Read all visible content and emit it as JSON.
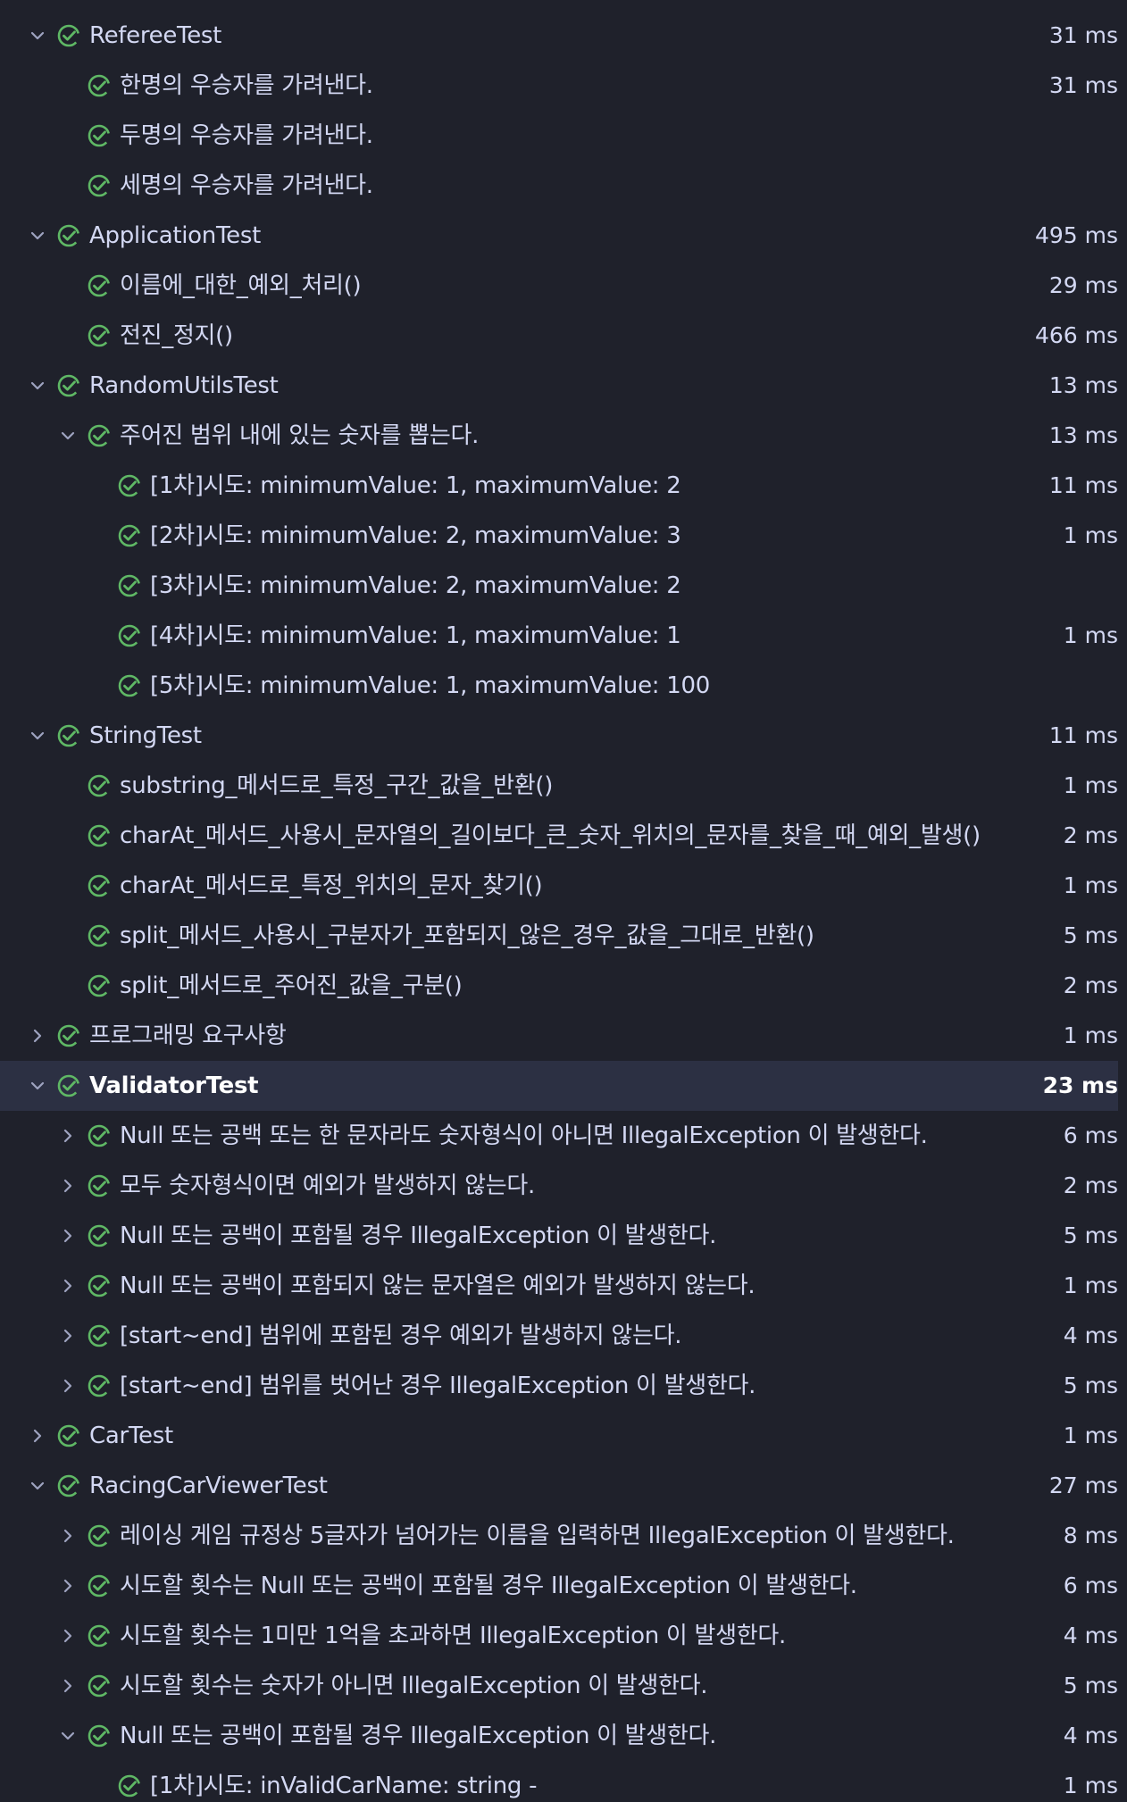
{
  "colors": {
    "background": "#1f212b",
    "selected_row": "#2c3043",
    "pass_icon": "#5fb865",
    "chevron": "#9ea3c0",
    "text": "#d3d8f3"
  },
  "rows": [
    {
      "level": 0,
      "expand": "expanded",
      "label": "RefereeTest",
      "time": "31 ms"
    },
    {
      "level": 1,
      "expand": "none",
      "label": "한명의 우승자를 가려낸다.",
      "time": "31 ms"
    },
    {
      "level": 1,
      "expand": "none",
      "label": "두명의 우승자를 가려낸다.",
      "time": ""
    },
    {
      "level": 1,
      "expand": "none",
      "label": "세명의 우승자를 가려낸다.",
      "time": ""
    },
    {
      "level": 0,
      "expand": "expanded",
      "label": "ApplicationTest",
      "time": "495 ms"
    },
    {
      "level": 1,
      "expand": "none",
      "label": "이름에_대한_예외_처리()",
      "time": "29 ms"
    },
    {
      "level": 1,
      "expand": "none",
      "label": "전진_정지()",
      "time": "466 ms"
    },
    {
      "level": 0,
      "expand": "expanded",
      "label": "RandomUtilsTest",
      "time": "13 ms"
    },
    {
      "level": 1,
      "expand": "expanded",
      "label": "주어진 범위 내에 있는 숫자를 뽑는다.",
      "time": "13 ms"
    },
    {
      "level": 2,
      "expand": "none",
      "label": "[1차]시도: minimumValue: 1, maximumValue: 2",
      "time": "11 ms"
    },
    {
      "level": 2,
      "expand": "none",
      "label": "[2차]시도: minimumValue: 2, maximumValue: 3",
      "time": "1 ms"
    },
    {
      "level": 2,
      "expand": "none",
      "label": "[3차]시도: minimumValue: 2, maximumValue: 2",
      "time": ""
    },
    {
      "level": 2,
      "expand": "none",
      "label": "[4차]시도: minimumValue: 1, maximumValue: 1",
      "time": "1 ms"
    },
    {
      "level": 2,
      "expand": "none",
      "label": "[5차]시도: minimumValue: 1, maximumValue: 100",
      "time": ""
    },
    {
      "level": 0,
      "expand": "expanded",
      "label": "StringTest",
      "time": "11 ms"
    },
    {
      "level": 1,
      "expand": "none",
      "label": "substring_메서드로_특정_구간_값을_반환()",
      "time": "1 ms"
    },
    {
      "level": 1,
      "expand": "none",
      "label": "charAt_메서드_사용시_문자열의_길이보다_큰_숫자_위치의_문자를_찾을_때_예외_발생()",
      "time": "2 ms"
    },
    {
      "level": 1,
      "expand": "none",
      "label": "charAt_메서드로_특정_위치의_문자_찾기()",
      "time": "1 ms"
    },
    {
      "level": 1,
      "expand": "none",
      "label": "split_메서드_사용시_구분자가_포함되지_않은_경우_값을_그대로_반환()",
      "time": "5 ms"
    },
    {
      "level": 1,
      "expand": "none",
      "label": "split_메서드로_주어진_값을_구분()",
      "time": "2 ms"
    },
    {
      "level": 0,
      "expand": "collapsed",
      "label": "프로그래밍 요구사항",
      "time": "1 ms"
    },
    {
      "level": 0,
      "expand": "expanded",
      "label": "ValidatorTest",
      "time": "23 ms",
      "selected": true
    },
    {
      "level": 1,
      "expand": "collapsed",
      "label": "Null 또는 공백 또는 한 문자라도 숫자형식이 아니면 IllegalException 이 발생한다.",
      "time": "6 ms"
    },
    {
      "level": 1,
      "expand": "collapsed",
      "label": "모두 숫자형식이면 예외가 발생하지 않는다.",
      "time": "2 ms"
    },
    {
      "level": 1,
      "expand": "collapsed",
      "label": "Null 또는 공백이 포함될 경우 IllegalException 이 발생한다.",
      "time": "5 ms"
    },
    {
      "level": 1,
      "expand": "collapsed",
      "label": "Null 또는 공백이 포함되지 않는 문자열은 예외가 발생하지 않는다.",
      "time": "1 ms"
    },
    {
      "level": 1,
      "expand": "collapsed",
      "label": "[start~end] 범위에 포함된 경우 예외가 발생하지 않는다.",
      "time": "4 ms"
    },
    {
      "level": 1,
      "expand": "collapsed",
      "label": "[start~end] 범위를 벗어난 경우  IllegalException 이 발생한다.",
      "time": "5 ms"
    },
    {
      "level": 0,
      "expand": "collapsed",
      "label": "CarTest",
      "time": "1 ms"
    },
    {
      "level": 0,
      "expand": "expanded",
      "label": "RacingCarViewerTest",
      "time": "27 ms"
    },
    {
      "level": 1,
      "expand": "collapsed",
      "label": "레이싱 게임 규정상 5글자가 넘어가는 이름을 입력하면 IllegalException 이 발생한다.",
      "time": "8 ms"
    },
    {
      "level": 1,
      "expand": "collapsed",
      "label": "시도할 횟수는 Null 또는 공백이 포함될 경우 IllegalException 이 발생한다.",
      "time": "6 ms"
    },
    {
      "level": 1,
      "expand": "collapsed",
      "label": "시도할 횟수는 1미만 1억을 초과하면 IllegalException 이 발생한다.",
      "time": "4 ms"
    },
    {
      "level": 1,
      "expand": "collapsed",
      "label": "시도할 횟수는 숫자가 아니면 IllegalException 이 발생한다.",
      "time": "5 ms"
    },
    {
      "level": 1,
      "expand": "expanded",
      "label": "Null 또는 공백이 포함될 경우 IllegalException 이 발생한다.",
      "time": "4 ms"
    },
    {
      "level": 2,
      "expand": "none",
      "label": "[1차]시도: inValidCarName: string  -",
      "time": "1 ms"
    }
  ]
}
